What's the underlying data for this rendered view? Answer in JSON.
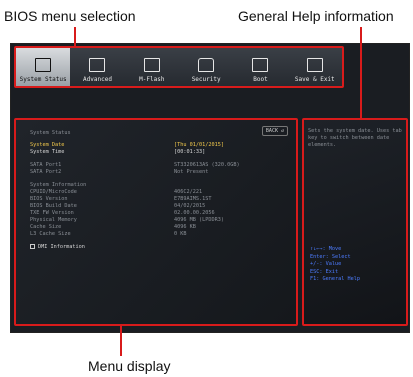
{
  "callouts": {
    "menu_selection": "BIOS menu selection",
    "general_help": "General Help information",
    "menu_display": "Menu display"
  },
  "tabs": [
    {
      "label": "System Status",
      "icon": "monitor-icon",
      "active": true
    },
    {
      "label": "Advanced",
      "icon": "sliders-icon",
      "active": false
    },
    {
      "label": "M-Flash",
      "icon": "chip-icon",
      "active": false
    },
    {
      "label": "Security",
      "icon": "lock-icon",
      "active": false
    },
    {
      "label": "Boot",
      "icon": "boot-icon",
      "active": false
    },
    {
      "label": "Save & Exit",
      "icon": "save-icon",
      "active": false
    }
  ],
  "menu": {
    "back_label": "BACK",
    "section_title": "System Status",
    "date_label": "System Date",
    "date_value": "[Thu 01/01/2015]",
    "time_label": "System Time",
    "time_value": "[00:01:33]",
    "sata1_label": "SATA Port1",
    "sata1_value": "ST3320613AS (320.0GB)",
    "sata2_label": "SATA Port2",
    "sata2_value": "Not Present",
    "info_title": "System Information",
    "cpuid_label": "CPUID/MicroCode",
    "cpuid_value": "406C2/221",
    "biosver_label": "BIOS Version",
    "biosver_value": "E7B9AIMS.1ST",
    "biosdate_label": "BIOS Build Date",
    "biosdate_value": "04/02/2015",
    "txe_label": "TXE FW Version",
    "txe_value": "02.00.00.2056",
    "mem_label": "Physical Memory",
    "mem_value": "4096 MB (LPDDR3)",
    "cache_label": "Cache Size",
    "cache_value": "4096 KB",
    "l3_label": "L3 Cache Size",
    "l3_value": "0 KB",
    "dmi_label": "DMI Information"
  },
  "help": {
    "text": "Sets the system date. Uses tab key to switch between date elements.",
    "keys": [
      "↑↓←→: Move",
      "Enter: Select",
      "+/-: Value",
      "ESC: Exit",
      "F1: General Help"
    ]
  },
  "colors": {
    "accent": "#d81b1b",
    "highlight": "#f2c94c",
    "key_help": "#4d7cff"
  }
}
